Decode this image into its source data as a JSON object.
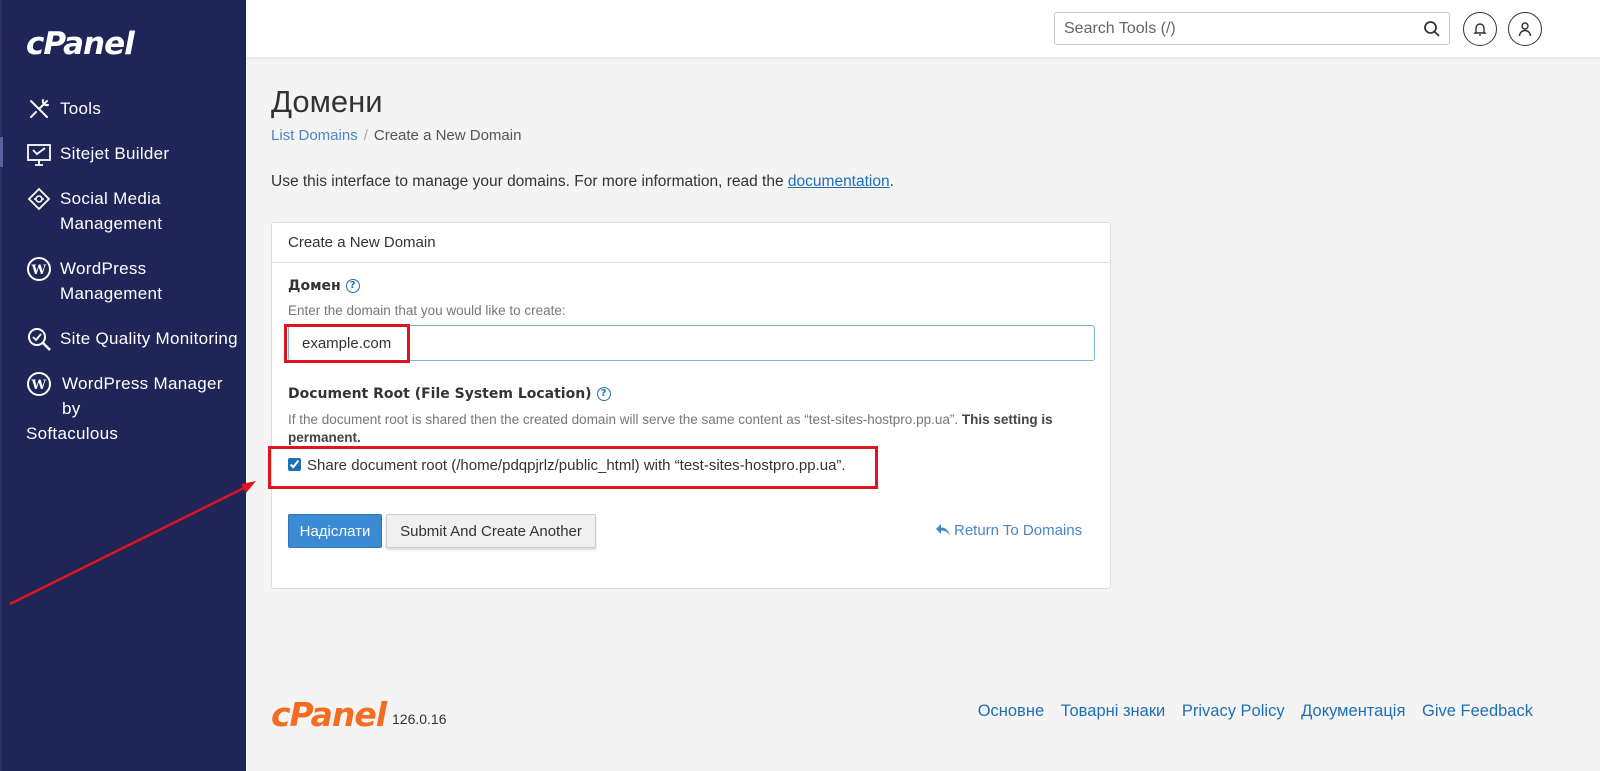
{
  "sidebar": {
    "logo": "cPanel",
    "items": [
      {
        "label": "Tools",
        "icon": "tools-icon"
      },
      {
        "label": "Sitejet Builder",
        "icon": "sitejet-icon"
      },
      {
        "label": "Social Media Management",
        "icon": "social-media-icon"
      },
      {
        "label": "WordPress Management",
        "icon": "wordpress-icon"
      },
      {
        "label": "Site Quality Monitoring",
        "icon": "site-quality-icon"
      },
      {
        "label": "WordPress Manager by",
        "label_tail": "Softaculous",
        "icon": "wordpress-icon"
      }
    ]
  },
  "header": {
    "search_placeholder": "Search Tools (/)"
  },
  "page": {
    "title": "Домени",
    "breadcrumb": {
      "parent": "List Domains",
      "separator": "/",
      "current": "Create a New Domain"
    },
    "intro_text": "Use this interface to manage your domains. For more information, read the ",
    "intro_link": "documentation",
    "intro_end": "."
  },
  "form": {
    "panel_title": "Create a New Domain",
    "domain_label": "Домен",
    "domain_hint": "Enter the domain that you would like to create:",
    "domain_value": "example.com",
    "docroot_label": "Document Root (File System Location)",
    "docroot_note": "If the document root is shared then the created domain will serve the same content as “test-sites-hostpro.pp.ua”. ",
    "docroot_note_bold": "This setting is permanent.",
    "share_label": "Share document root (/home/pdqpjrlz/public_html) with “test-sites-hostpro.pp.ua”.",
    "share_checked": true,
    "submit_label": "Надіслати",
    "submit_another_label": "Submit And Create Another",
    "return_label": "Return To Domains"
  },
  "footer": {
    "logo": "cPanel",
    "version": "126.0.16",
    "links": [
      "Основне",
      "Товарні знаки",
      "Privacy Policy",
      "Документація",
      "Give Feedback"
    ]
  },
  "colors": {
    "sidebar_bg": "#1f2557",
    "accent": "#3a8ad4",
    "link": "#1f6fb5",
    "highlight": "#e0141e",
    "brand_orange": "#f36c21"
  }
}
